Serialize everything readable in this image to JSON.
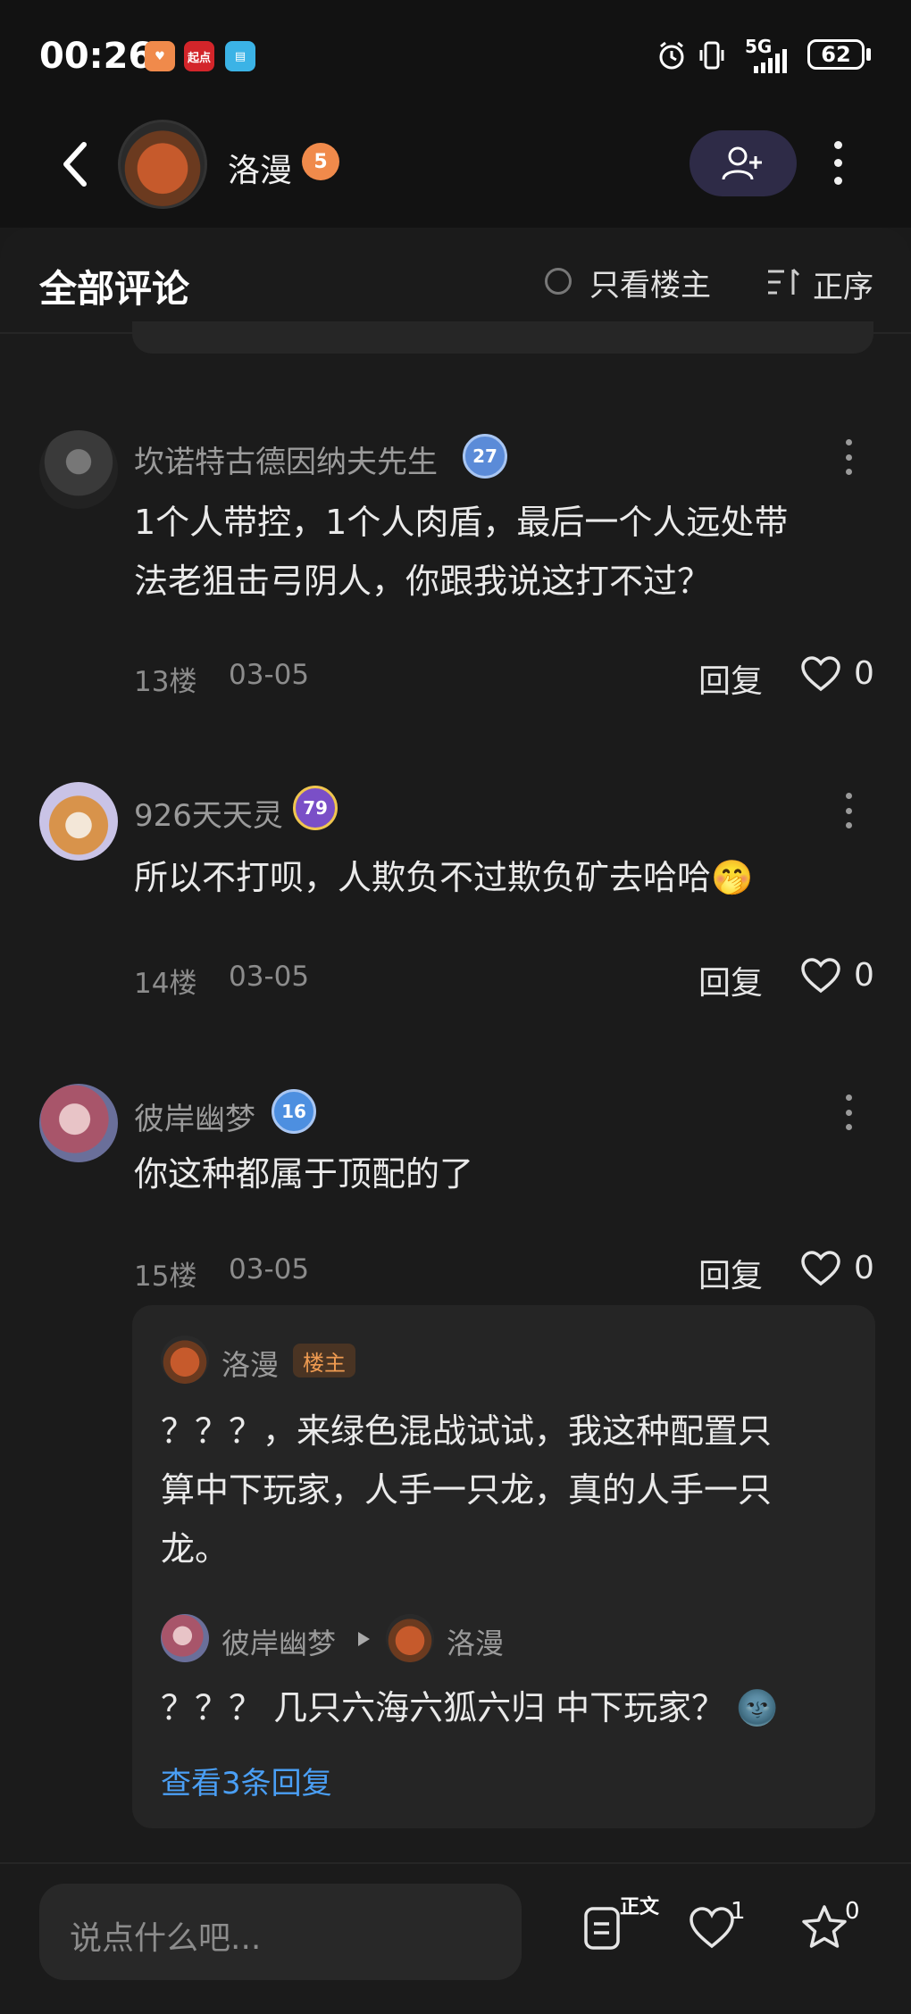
{
  "status_bar": {
    "time": "00:26",
    "app_badges": [
      {
        "label": "",
        "color": "#f08a4b"
      },
      {
        "label": "起点",
        "color": "#d3252a"
      },
      {
        "label": "",
        "color": "#3bb3e6"
      }
    ],
    "network": "5G",
    "battery": "62"
  },
  "header": {
    "owner_name": "洛漫",
    "owner_level": "5"
  },
  "comments_header": {
    "title": "全部评论",
    "only_op_label": "只看楼主",
    "sort_label": "正序"
  },
  "comments": [
    {
      "username": "坎诺特古德因纳夫先生",
      "level": "27",
      "text_lines": [
        "1个人带控，1个人肉盾，最后一个人远处带",
        "法老狙击弓阴人，你跟我说这打不过？"
      ],
      "floor": "13楼",
      "date": "03-05",
      "reply_label": "回复",
      "likes": "0"
    },
    {
      "username": "926天天灵",
      "level": "79",
      "text_lines": [
        "所以不打呗，人欺负不过欺负矿去哈哈🤭"
      ],
      "floor": "14楼",
      "date": "03-05",
      "reply_label": "回复",
      "likes": "0"
    },
    {
      "username": "彼岸幽梦",
      "level": "16",
      "text_lines": [
        "你这种都属于顶配的了"
      ],
      "floor": "15楼",
      "date": "03-05",
      "reply_label": "回复",
      "likes": "0"
    }
  ],
  "replies": {
    "first": {
      "username": "洛漫",
      "tag": "楼主",
      "text_lines": [
        "？？？，来绿色混战试试，我这种配置只",
        "算中下玩家，人手一只龙，真的人手一只",
        "龙。"
      ]
    },
    "second": {
      "from": "彼岸幽梦",
      "to": "洛漫",
      "text": "？？？ 几只六海六狐六归 中下玩家？ 🌚"
    },
    "view_more": "查看3条回复"
  },
  "bottom_bar": {
    "input_placeholder": "说点什么吧...",
    "doc_label": "正文",
    "likes": "1",
    "stars": "0"
  },
  "colors": {
    "background": "#1a1a1a",
    "accent_link": "#4a9ff5",
    "op_tag": "#ef9b51",
    "follow_button": "#2e2b47"
  }
}
